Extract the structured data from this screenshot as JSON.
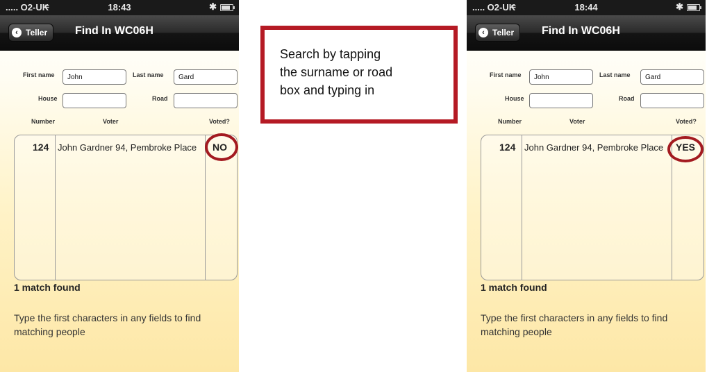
{
  "left_phone": {
    "status": {
      "carrier": "..... O2-UK",
      "time": "18:43"
    },
    "nav": {
      "back_label": "Teller",
      "title": "Find In WC06H"
    },
    "form": {
      "first_name_label": "First name",
      "first_name_value": "John",
      "last_name_label": "Last name",
      "last_name_value": "Gard",
      "house_label": "House",
      "house_value": "",
      "road_label": "Road",
      "road_value": ""
    },
    "columns": {
      "number": "Number",
      "voter": "Voter",
      "voted": "Voted?"
    },
    "rows": [
      {
        "number": "124",
        "voter": "John Gardner 94, Pembroke Place",
        "voted": "NO"
      }
    ],
    "match_text": "1 match found",
    "help_text": "Type the first characters in any fields to find matching people"
  },
  "right_phone": {
    "status": {
      "carrier": "..... O2-UK",
      "time": "18:44"
    },
    "nav": {
      "back_label": "Teller",
      "title": "Find In WC06H"
    },
    "form": {
      "first_name_label": "First name",
      "first_name_value": "John",
      "last_name_label": "Last name",
      "last_name_value": "Gard",
      "house_label": "House",
      "house_value": "",
      "road_label": "Road",
      "road_value": ""
    },
    "columns": {
      "number": "Number",
      "voter": "Voter",
      "voted": "Voted?"
    },
    "rows": [
      {
        "number": "124",
        "voter": "John Gardner 94, Pembroke Place",
        "voted": "YES"
      }
    ],
    "match_text": "1 match found",
    "help_text": "Type the first characters in any fields to find matching people"
  },
  "callout": {
    "text": "Search by tapping\nthe surname or road\nbox and typing in"
  },
  "colors": {
    "highlight": "#a31a20",
    "callout_border": "#b51a24",
    "navbar": "#1e1e1e"
  }
}
